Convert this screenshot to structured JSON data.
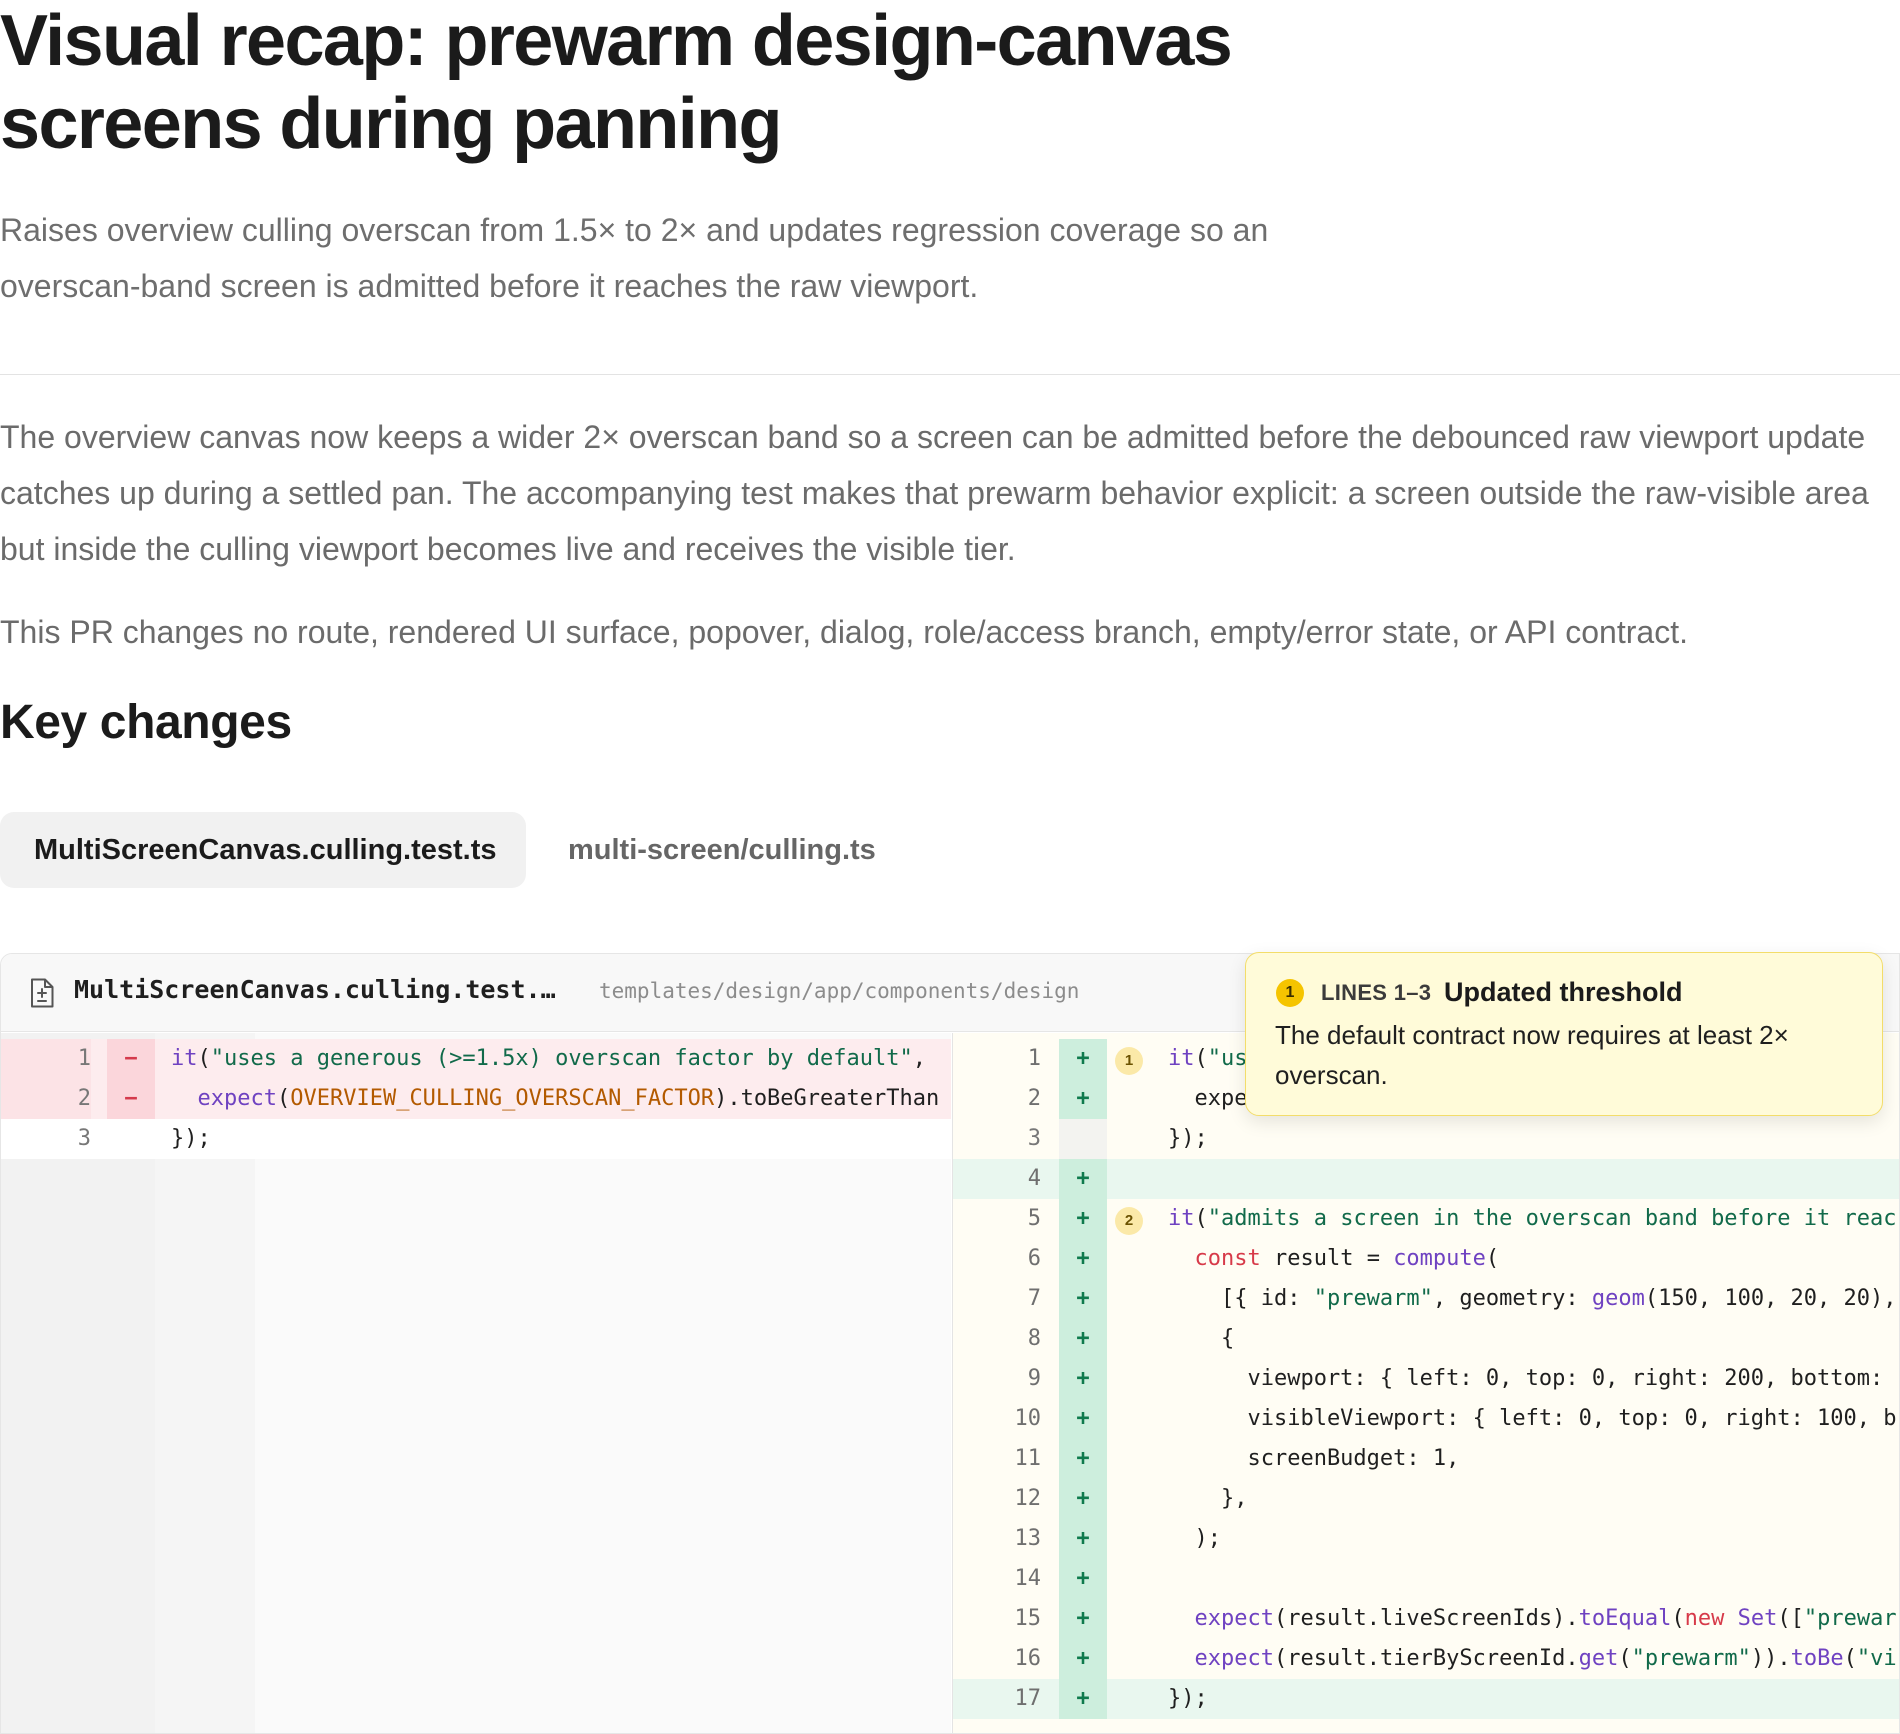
{
  "page": {
    "title": "Visual recap: prewarm design-canvas screens during panning",
    "subtitle": "Raises overview culling overscan from 1.5× to 2× and updates regression coverage so an overscan-band screen is admitted before it reaches the raw viewport.",
    "paragraphs": [
      "The overview canvas now keeps a wider 2× overscan band so a screen can be admitted before the debounced raw viewport update catches up during a settled pan. The accompanying test makes that prewarm behavior explicit: a screen outside the raw-visible area but inside the culling viewport becomes live and receives the visible tier.",
      "This PR changes no route, rendered UI surface, popover, dialog, role/access branch, empty/error state, or API contract."
    ],
    "section_heading": "Key changes"
  },
  "tabs": [
    {
      "label": "MultiScreenCanvas.culling.test.ts",
      "active": true
    },
    {
      "label": "multi-screen/culling.ts",
      "active": false
    }
  ],
  "diff": {
    "file_name": "MultiScreenCanvas.culling.test.…",
    "file_path": "templates/design/app/components/design",
    "icon": "file-diff-icon",
    "colors": {
      "deleted_bg": "#fdecee",
      "added_bg": "#e9f7ef",
      "added_sign": "#0f7a4d",
      "deleted_sign": "#d43a4c",
      "annotation_bg": "#fffbd9"
    },
    "left_lines": [
      {
        "ln": "1",
        "sign": "−",
        "type": "del",
        "code": "it(\"uses a generous (>=1.5x) overscan factor by default\","
      },
      {
        "ln": "2",
        "sign": "−",
        "type": "del",
        "code": "  expect(OVERVIEW_CULLING_OVERSCAN_FACTOR).toBeGreaterThan"
      },
      {
        "ln": "3",
        "sign": "",
        "type": "ctx",
        "code": "});"
      }
    ],
    "right_lines": [
      {
        "ln": "1",
        "sign": "+",
        "type": "add",
        "hl": false,
        "badge": "1",
        "code": "it(\"us"
      },
      {
        "ln": "2",
        "sign": "+",
        "type": "add",
        "hl": false,
        "badge": "",
        "code": "  expe"
      },
      {
        "ln": "3",
        "sign": "",
        "type": "ctx",
        "hl": false,
        "badge": "",
        "code": "});"
      },
      {
        "ln": "4",
        "sign": "+",
        "type": "add",
        "hl": true,
        "badge": "",
        "code": ""
      },
      {
        "ln": "5",
        "sign": "+",
        "type": "add",
        "hl": false,
        "badge": "2",
        "code": "it(\"admits a screen in the overscan band before it reac"
      },
      {
        "ln": "6",
        "sign": "+",
        "type": "add",
        "hl": false,
        "badge": "",
        "code": "  const result = compute("
      },
      {
        "ln": "7",
        "sign": "+",
        "type": "add",
        "hl": false,
        "badge": "",
        "code": "    [{ id: \"prewarm\", geometry: geom(150, 100, 20, 20),"
      },
      {
        "ln": "8",
        "sign": "+",
        "type": "add",
        "hl": false,
        "badge": "",
        "code": "    {"
      },
      {
        "ln": "9",
        "sign": "+",
        "type": "add",
        "hl": false,
        "badge": "",
        "code": "      viewport: { left: 0, top: 0, right: 200, bottom:"
      },
      {
        "ln": "10",
        "sign": "+",
        "type": "add",
        "hl": false,
        "badge": "",
        "code": "      visibleViewport: { left: 0, top: 0, right: 100, b"
      },
      {
        "ln": "11",
        "sign": "+",
        "type": "add",
        "hl": false,
        "badge": "",
        "code": "      screenBudget: 1,"
      },
      {
        "ln": "12",
        "sign": "+",
        "type": "add",
        "hl": false,
        "badge": "",
        "code": "    },"
      },
      {
        "ln": "13",
        "sign": "+",
        "type": "add",
        "hl": false,
        "badge": "",
        "code": "  );"
      },
      {
        "ln": "14",
        "sign": "+",
        "type": "add",
        "hl": false,
        "badge": "",
        "code": ""
      },
      {
        "ln": "15",
        "sign": "+",
        "type": "add",
        "hl": false,
        "badge": "",
        "code": "  expect(result.liveScreenIds).toEqual(new Set([\"prewar"
      },
      {
        "ln": "16",
        "sign": "+",
        "type": "add",
        "hl": false,
        "badge": "",
        "code": "  expect(result.tierByScreenId.get(\"prewarm\")).toBe(\"vi"
      },
      {
        "ln": "17",
        "sign": "+",
        "type": "add",
        "hl": true,
        "badge": "",
        "code": "});"
      }
    ]
  },
  "annotation": {
    "badge": "1",
    "label": "LINES 1–3",
    "title": "Updated threshold",
    "body": "The default contract now requires at least 2× overscan."
  }
}
